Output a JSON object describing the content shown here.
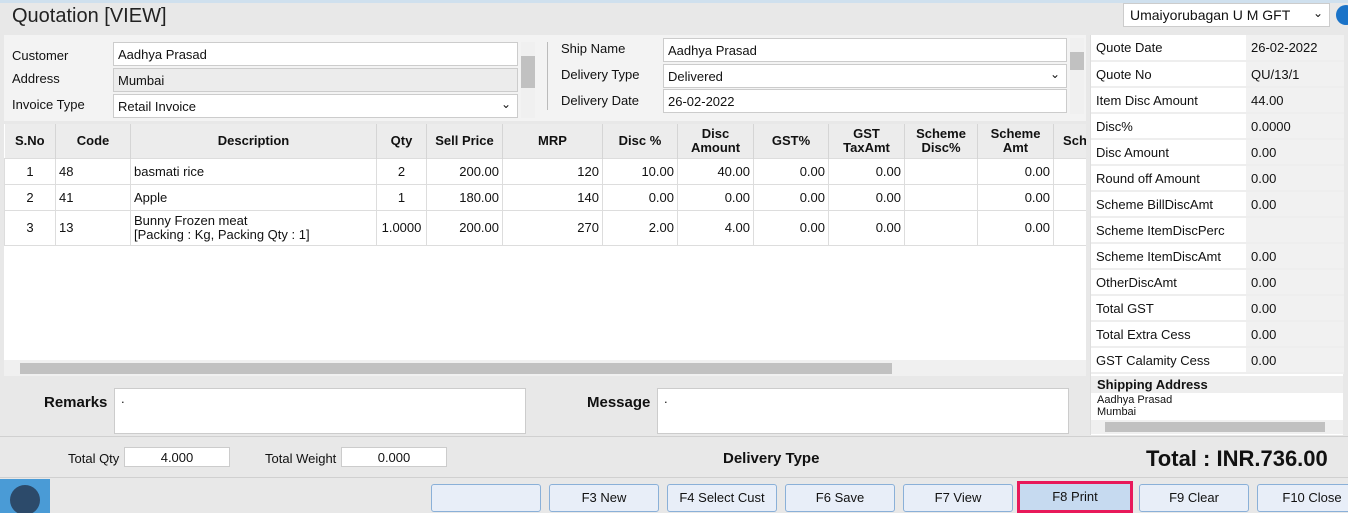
{
  "title": "Quotation [VIEW]",
  "branch": "Umaiyorubagan U M GFT",
  "header": {
    "customer_label": "Customer",
    "customer": "Aadhya Prasad",
    "address_label": "Address",
    "address": "Mumbai",
    "invoice_type_label": "Invoice Type",
    "invoice_type": "Retail Invoice",
    "ship_name_label": "Ship Name",
    "ship_name": "Aadhya Prasad",
    "delivery_type_label": "Delivery Type",
    "delivery_type": "Delivered",
    "delivery_date_label": "Delivery Date",
    "delivery_date": "26-02-2022"
  },
  "grid": {
    "columns": [
      "S.No",
      "Code",
      "Description",
      "Qty",
      "Sell Price",
      "MRP",
      "Disc %",
      "Disc Amount",
      "GST%",
      "GST TaxAmt",
      "Scheme Disc%",
      "Scheme Amt",
      "Sch Ot"
    ],
    "rows": [
      {
        "sno": "1",
        "code": "48",
        "desc": "basmati rice",
        "desc2": "",
        "qty": "2",
        "sell": "200.00",
        "mrp": "120",
        "disc": "10.00",
        "discamt": "40.00",
        "gst": "0.00",
        "gsttax": "0.00",
        "schdisc": "",
        "schamt": "0.00"
      },
      {
        "sno": "2",
        "code": "41",
        "desc": "Apple",
        "desc2": "",
        "qty": "1",
        "sell": "180.00",
        "mrp": "140",
        "disc": "0.00",
        "discamt": "0.00",
        "gst": "0.00",
        "gsttax": "0.00",
        "schdisc": "",
        "schamt": "0.00"
      },
      {
        "sno": "3",
        "code": "13",
        "desc": "Bunny Frozen meat",
        "desc2": "[Packing : Kg, Packing Qty : 1]",
        "qty": "1.0000",
        "sell": "200.00",
        "mrp": "270",
        "disc": "2.00",
        "discamt": "4.00",
        "gst": "0.00",
        "gsttax": "0.00",
        "schdisc": "",
        "schamt": "0.00"
      }
    ]
  },
  "summary": [
    {
      "k": "Quote Date",
      "v": "26-02-2022"
    },
    {
      "k": "Quote No",
      "v": "QU/13/1"
    },
    {
      "k": "Item Disc Amount",
      "v": "44.00"
    },
    {
      "k": "Disc%",
      "v": "0.0000"
    },
    {
      "k": "Disc Amount",
      "v": "0.00"
    },
    {
      "k": "Round off Amount",
      "v": "0.00"
    },
    {
      "k": "Scheme BillDiscAmt",
      "v": "0.00"
    },
    {
      "k": "Scheme ItemDiscPerc",
      "v": ""
    },
    {
      "k": "Scheme ItemDiscAmt",
      "v": "0.00"
    },
    {
      "k": "OtherDiscAmt",
      "v": "0.00"
    },
    {
      "k": "Total GST",
      "v": "0.00"
    },
    {
      "k": "Total Extra Cess",
      "v": "0.00"
    },
    {
      "k": "GST Calamity Cess",
      "v": "0.00"
    }
  ],
  "shipping": {
    "label": "Shipping Address",
    "line1": "Aadhya Prasad",
    "line2": "Mumbai"
  },
  "remarks_label": "Remarks",
  "remarks": ".",
  "message_label": "Message",
  "message": ".",
  "total_qty_label": "Total Qty",
  "total_qty": "4.000",
  "total_weight_label": "Total Weight",
  "total_weight": "0.000",
  "delivery_type_footer": "Delivery Type",
  "total": "Total : INR.736.00",
  "buttons": [
    "",
    "F3 New",
    "F4 Select Cust",
    "F6 Save",
    "F7 View",
    "F8 Print",
    "F9 Clear",
    "F10 Close"
  ],
  "colors": {
    "highlight": "#e8195a",
    "button_bg": "#e8eef8"
  }
}
